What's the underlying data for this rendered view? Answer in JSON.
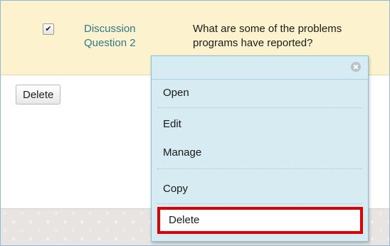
{
  "row": {
    "title": "Discussion Question 2",
    "title_line1": "Discussion",
    "title_line2": "Question 2",
    "description_line1": "What are some of the problems",
    "description_line2": "programs have reported?",
    "checked_glyph": "✔"
  },
  "toolbar": {
    "delete_label": "Delete"
  },
  "context_menu": {
    "items": [
      {
        "label": "Open"
      },
      {
        "label": "Edit"
      },
      {
        "label": "Manage"
      },
      {
        "label": "Copy"
      },
      {
        "label": "Delete",
        "highlighted": true
      }
    ],
    "highlight_color": "#e30000"
  },
  "colors": {
    "row_highlight": "#fcf3ce",
    "menu_background": "#d6ebf2",
    "link_color": "#2c7a8c"
  }
}
